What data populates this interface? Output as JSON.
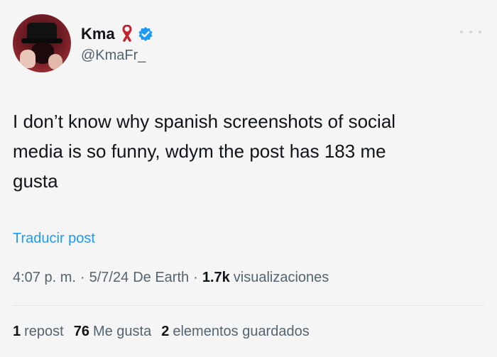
{
  "user": {
    "display_name": "Kma",
    "handle": "@KmaFr_",
    "ribbon_icon": "awareness-ribbon-icon",
    "verified_icon": "verified-badge-icon"
  },
  "post": {
    "text": "I don’t know why spanish screenshots of social\nmedia is so funny, wdym the post has 183 me\ngusta",
    "translate_label": "Traducir post",
    "time": "4:07 p. m.",
    "date": "5/7/24",
    "source": "De Earth",
    "views_count": "1.7k",
    "views_label": "visualizaciones"
  },
  "stats": {
    "reposts_count": "1",
    "reposts_label": "repost",
    "likes_count": "76",
    "likes_label": "Me gusta",
    "bookmarks_count": "2",
    "bookmarks_label": "elementos guardados"
  },
  "colors": {
    "accent": "#1d9bf0",
    "secondary_text": "#536471",
    "ribbon": "#c0242e"
  }
}
